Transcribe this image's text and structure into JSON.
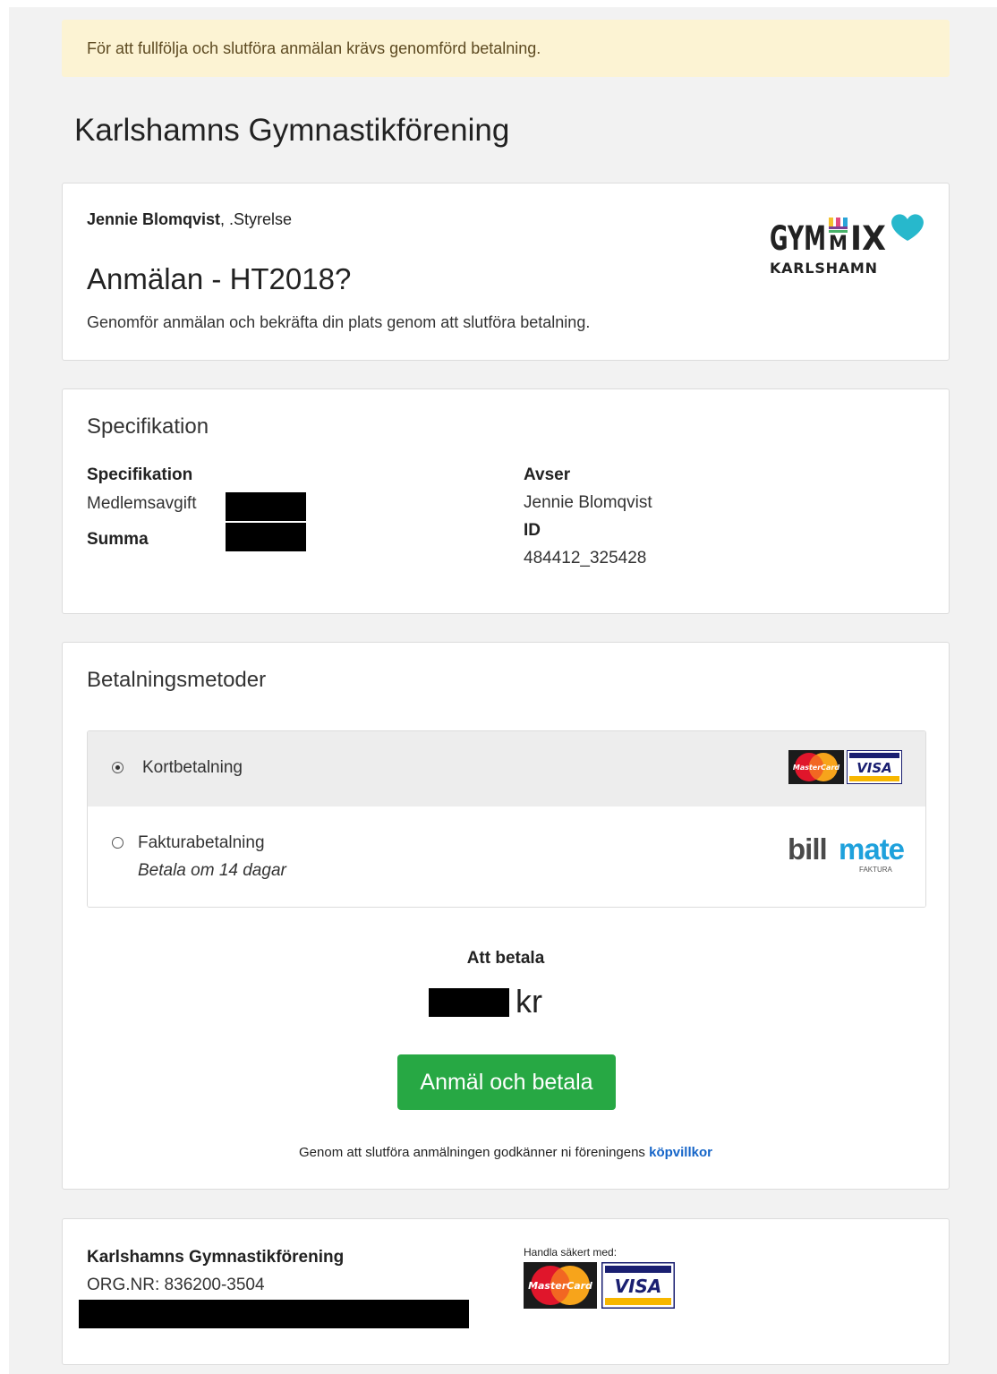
{
  "alert": {
    "text": "För att fullfölja och slutföra anmälan krävs genomförd betalning."
  },
  "org": {
    "title": "Karlshamns Gymnastikförening"
  },
  "event": {
    "sender_name": "Jennie Blomqvist",
    "sender_role": ", .Styrelse",
    "title": "Anmälan - HT2018?",
    "description": "Genomför anmälan och bekräfta din plats genom att slutföra betalning.",
    "logo_text_top_left": "GYM",
    "logo_text_top_mid": "M",
    "logo_text_top_right": "IX",
    "logo_text_bottom": "KARLSHAMN"
  },
  "specification": {
    "section_title": "Specifikation",
    "col1_heading": "Specifikation",
    "item_label": "Medlemsavgift",
    "sum_label": "Summa",
    "col2_heading": "Avser",
    "avser_value": "Jennie Blomqvist",
    "id_label": "ID",
    "id_value": "484412_325428"
  },
  "payment": {
    "section_title": "Betalningsmetoder",
    "methods": [
      {
        "label": "Kortbetalning",
        "selected": true
      },
      {
        "label": "Fakturabetalning",
        "sublabel": "Betala om 14 dagar",
        "selected": false
      }
    ],
    "billmate_logo": {
      "bill": "bill",
      "mate": "mate",
      "sub": "FAKTURA"
    },
    "to_pay_label": "Att betala",
    "currency": "kr",
    "button_label": "Anmäl och betala",
    "terms_text": "Genom att slutföra anmälningen godkänner ni föreningens ",
    "terms_link": "köpvillkor"
  },
  "card_logos": {
    "mastercard": "MasterCard",
    "visa": "VISA"
  },
  "footer": {
    "org_name": "Karlshamns Gymnastikförening",
    "org_nr": "ORG.NR: 836200-3504",
    "secure_label": "Handla säkert med:"
  },
  "colors": {
    "alert_bg": "#fcf3d3",
    "button": "#27a844",
    "link": "#1565c8",
    "billmate_blue": "#1ea1dc",
    "logo_heart": "#27b8cc"
  }
}
